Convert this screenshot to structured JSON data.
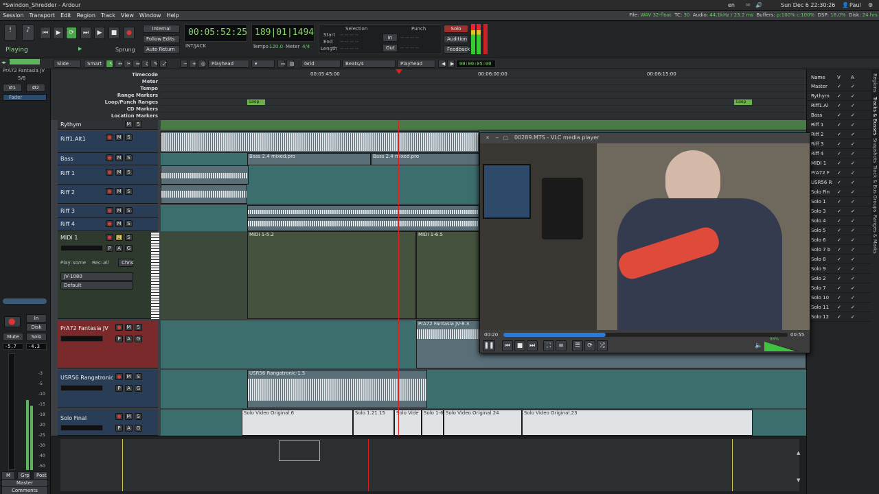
{
  "window": {
    "title": "*Swindon_Shredder - Ardour"
  },
  "system_tray": {
    "lang": "en",
    "datetime": "Sun Dec 6 22:30:26",
    "user": "Paul"
  },
  "menu": [
    "Session",
    "Transport",
    "Edit",
    "Region",
    "Track",
    "View",
    "Window",
    "Help"
  ],
  "status_line": {
    "file_label": "File:",
    "file_value": "WAV 32-float",
    "tc_label": "TC:",
    "tc_value": "30",
    "audio_label": "Audio:",
    "audio_value": "44.1kHz / 23.2 ms",
    "buffers_label": "Buffers:",
    "buffers_value": "p:100% c:100%",
    "dsp_label": "DSP:",
    "dsp_value": "18.0%",
    "disk_label": "Disk:",
    "disk_value": "24 hrs"
  },
  "transport": {
    "state": "Playing",
    "mode": "Sprung",
    "sync_source": "Internal",
    "follow_edits": "Follow Edits",
    "auto_return": "Auto Return",
    "int_jack": "INT/JACK",
    "primary_clock": "00:05:52:25",
    "secondary_clock": "189|01|1494",
    "tempo_label": "Tempo",
    "tempo_value": "120.0",
    "meter_label": "Meter",
    "meter_value": "4/4",
    "selection_label": "Selection",
    "punch_label": "Punch",
    "start_label": "Start",
    "end_label": "End",
    "length_label": "Length",
    "in_label": "In",
    "out_label": "Out",
    "solo_label": "Solo",
    "audition_label": "Audition",
    "feedback_label": "Feedback",
    "empty_clock": "-- -- -- --"
  },
  "editor_toolbar": {
    "edit_mode": "Slide",
    "smart": "Smart",
    "edit_point": "Playhead",
    "grid": "Grid",
    "grid_value": "Beats/4",
    "playhead": "Playhead",
    "nudge_clock": "00:00:05:00"
  },
  "left_panel": {
    "track_name": "PrA72 Fantasia JV",
    "ratio": "5/6",
    "in1": "Ø1",
    "in2": "Ø2",
    "fader_label": "Fader",
    "in_label": "In",
    "disk_label": "Disk",
    "mute": "Mute",
    "solo": "Solo",
    "gain_left": "-5.7",
    "gain_right": "-4.3",
    "m_label": "M",
    "grp_label": "Grp",
    "post_label": "Post",
    "strip_name": "Master",
    "comments": "Comments",
    "meter_ticks": [
      "-3",
      "-5",
      "-10",
      "-15",
      "-18",
      "-20",
      "-25",
      "-30",
      "-40",
      "-50"
    ]
  },
  "rulers": {
    "labels": [
      "Timecode",
      "Meter",
      "Tempo",
      "Range Markers",
      "Loop/Punch Ranges",
      "CD Markers",
      "Location Markers"
    ],
    "timecode_ticks": [
      "00:05:45:00",
      "00:06:00:00",
      "00:06:15:00"
    ],
    "loop_label": "Loop",
    "loop_label_2": "Loop"
  },
  "tracks": [
    {
      "name": "Rythym",
      "type": "bus"
    },
    {
      "name": "Riff1.Alt1"
    },
    {
      "name": "Bass"
    },
    {
      "name": "Riff 1"
    },
    {
      "name": "Riff 2"
    },
    {
      "name": "Riff 3"
    },
    {
      "name": "Riff 4"
    },
    {
      "name": "MIDI 1",
      "play_label": "Play:",
      "play_value": "some",
      "rec_label": "Rec:",
      "rec_value": "all",
      "chns": "Chns",
      "instrument": "JV-1080",
      "bank": "Default"
    },
    {
      "name": "PrA72 Fantasia JV"
    },
    {
      "name": "USR56 Rangatronic"
    },
    {
      "name": "Solo Final"
    }
  ],
  "track_buttons": {
    "rec": "",
    "mute": "M",
    "solo": "S",
    "play": "P",
    "auto": "A",
    "group": "G"
  },
  "regions": {
    "bass_a": "Bass 2.4 mixed.pro",
    "bass_b": "Bass 2.4 mixed.pro",
    "midi_a": "MIDI 1-5.2",
    "midi_b": "MIDI 1-6.5",
    "prA72": "PrA72 Fantasia JV-8.3",
    "usr56": "USR56 Rangatronic-1.5",
    "solo_1": "Solo Video Original.6",
    "solo_2": "Solo 1.21.15",
    "solo_3": "Solo Vide",
    "solo_4": "Solo 1-6",
    "solo_5": "Solo Video Original.24",
    "solo_6": "Solo Video Original.23"
  },
  "vlc": {
    "title": "00289.MTS - VLC media player",
    "elapsed": "00:20",
    "total": "00:55",
    "progress": 0.36,
    "volume_label": "88%",
    "volume": 0.88
  },
  "right_panel": {
    "headers": {
      "name": "Name",
      "v": "V",
      "a": "A"
    },
    "tabs": [
      "Regions",
      "Tracks & Busses",
      "Snapshots",
      "Track & Bus Groups",
      "Ranges & Marks"
    ],
    "rows": [
      "Master",
      "Rythym",
      "Riff1.Al",
      "Bass",
      "Riff 1",
      "Riff 2",
      "Riff 3",
      "Riff 4",
      "MIDI 1",
      "PrA72 F",
      "USR56 R",
      "Solo Fin",
      "Solo 1",
      "Solo 3",
      "Solo 4",
      "Solo 5",
      "Solo 6",
      "Solo 7 b",
      "Solo 8",
      "Solo 9",
      "Solo 2",
      "Solo 7",
      "Solo 10",
      "Solo 11",
      "Solo 12"
    ],
    "check": "✓"
  },
  "colors": {
    "playhead": "#e02020",
    "accent_green": "#6bd06b",
    "track_blue": "#2a3d56",
    "lane_teal": "#3c6e6e",
    "record_red": "#e03535"
  }
}
